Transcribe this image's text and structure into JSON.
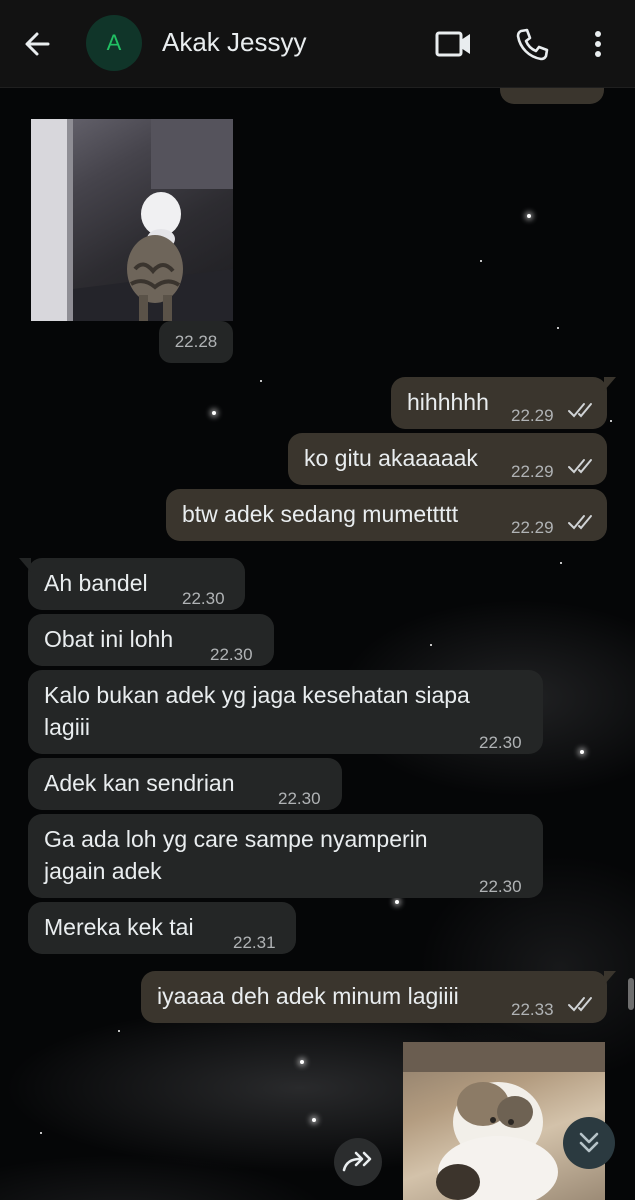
{
  "header": {
    "avatar_initial": "A",
    "contact_name": "Akak Jessyy",
    "back_icon": "arrow-left-icon",
    "video_icon": "video-camera-icon",
    "call_icon": "phone-icon",
    "menu_icon": "more-vertical-icon"
  },
  "colors": {
    "header_bg": "#121212",
    "incoming_bubble": "#242626",
    "outgoing_bubble": "#3a352d",
    "avatar_bg": "#103529",
    "avatar_letter": "#21c063",
    "read_ticks": "#b0b3b5"
  },
  "messages": [
    {
      "direction": "in",
      "type": "image",
      "image_description": "cat",
      "time": "22.28"
    },
    {
      "direction": "out",
      "text": "hihhhhh",
      "time": "22.29",
      "status": "read"
    },
    {
      "direction": "out",
      "text": "ko gitu akaaaaak",
      "time": "22.29",
      "status": "read"
    },
    {
      "direction": "out",
      "text": "btw adek sedang mumettttt",
      "time": "22.29",
      "status": "read"
    },
    {
      "direction": "in",
      "text": "Ah bandel",
      "time": "22.30"
    },
    {
      "direction": "in",
      "text": "Obat ini lohh",
      "time": "22.30"
    },
    {
      "direction": "in",
      "text_lines": [
        "Kalo bukan adek yg jaga kesehatan siapa",
        "lagiii"
      ],
      "time": "22.30"
    },
    {
      "direction": "in",
      "text": "Adek kan sendrian",
      "time": "22.30"
    },
    {
      "direction": "in",
      "text_lines": [
        "Ga ada loh yg care sampe nyamperin",
        "jagain adek"
      ],
      "time": "22.30"
    },
    {
      "direction": "in",
      "text": "Mereka kek tai",
      "time": "22.31"
    },
    {
      "direction": "out",
      "text": "iyaaaa deh adek minum lagiiii",
      "time": "22.33",
      "status": "read"
    },
    {
      "direction": "out",
      "type": "image",
      "image_description": "cat"
    }
  ],
  "floating": {
    "forward_icon": "forward-arrows-icon",
    "scroll_down_icon": "double-chevron-down-icon"
  }
}
